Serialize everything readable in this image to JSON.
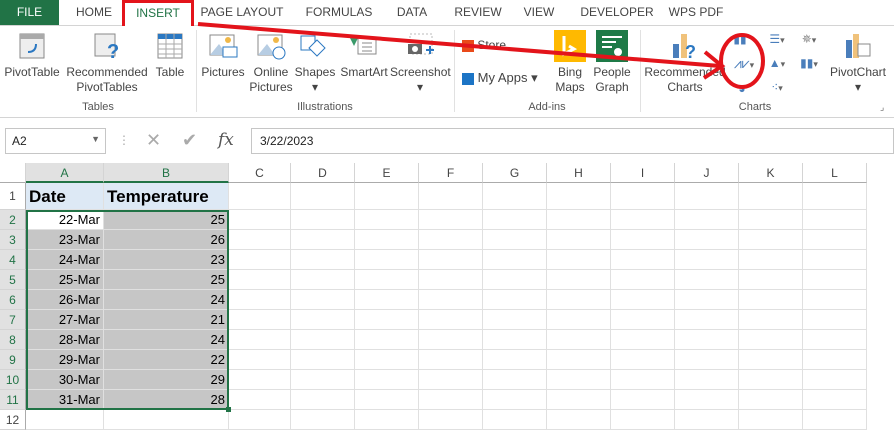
{
  "tabs": [
    "FILE",
    "HOME",
    "INSERT",
    "PAGE LAYOUT",
    "FORMULAS",
    "DATA",
    "REVIEW",
    "VIEW",
    "DEVELOPER",
    "WPS PDF"
  ],
  "ribbon": {
    "tables": {
      "pivot": "PivotTable",
      "rec1": "Recommended",
      "rec2": "PivotTables",
      "table": "Table",
      "label": "Tables"
    },
    "illus": {
      "pictures": "Pictures",
      "online1": "Online",
      "online2": "Pictures",
      "shapes": "Shapes",
      "smartart": "SmartArt",
      "screenshot": "Screenshot",
      "label": "Illustrations"
    },
    "addins": {
      "store": "Store",
      "myapps": "My Apps",
      "bing1": "Bing",
      "bing2": "Maps",
      "people1": "People",
      "people2": "Graph",
      "label": "Add-ins"
    },
    "charts": {
      "rec1": "Recommended",
      "rec2": "Charts",
      "pivot": "PivotChart",
      "label": "Charts"
    }
  },
  "formula": {
    "namebox": "A2",
    "fx": "fx",
    "value": "3/22/2023"
  },
  "columns": [
    "A",
    "B",
    "C",
    "D",
    "E",
    "F",
    "G",
    "H",
    "I",
    "J",
    "K",
    "L"
  ],
  "rows": [
    "1",
    "2",
    "3",
    "4",
    "5",
    "6",
    "7",
    "8",
    "9",
    "10",
    "11",
    "12"
  ],
  "headers": {
    "a": "Date",
    "b": "Temperature"
  },
  "data": [
    [
      "22-Mar",
      "25"
    ],
    [
      "23-Mar",
      "26"
    ],
    [
      "24-Mar",
      "23"
    ],
    [
      "25-Mar",
      "25"
    ],
    [
      "26-Mar",
      "24"
    ],
    [
      "27-Mar",
      "21"
    ],
    [
      "28-Mar",
      "24"
    ],
    [
      "29-Mar",
      "22"
    ],
    [
      "30-Mar",
      "29"
    ],
    [
      "31-Mar",
      "28"
    ]
  ]
}
